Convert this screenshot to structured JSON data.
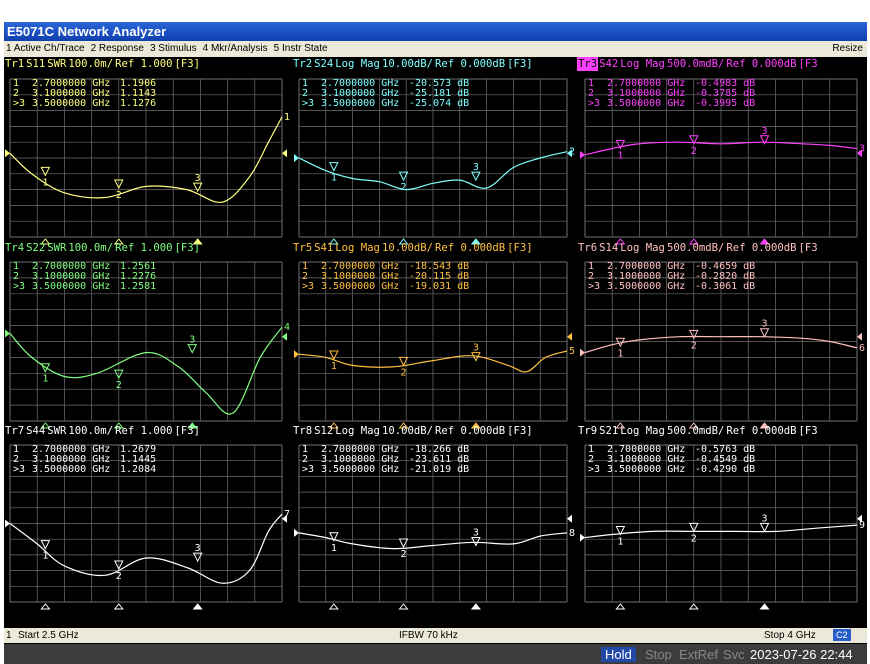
{
  "window": {
    "title": "E5071C Network Analyzer"
  },
  "menu": {
    "items": [
      "1 Active Ch/Trace",
      "2 Response",
      "3 Stimulus",
      "4 Mkr/Analysis",
      "5 Instr State"
    ],
    "resize": "Resize"
  },
  "colors": {
    "grid": "#707070",
    "background": "#000000"
  },
  "panels": [
    {
      "tr": "Tr1",
      "param": "S11",
      "format": "SWR",
      "scale": "100.0m/",
      "ref": "Ref 1.000",
      "tag": "[F3]",
      "color": "#ffff80",
      "active": false,
      "end_label": "1",
      "markers": [
        {
          "n": "1",
          "freq": "2.7000000 GHz",
          "value": "1.1906"
        },
        {
          "n": "2",
          "freq": "3.1000000 GHz",
          "value": "1.1143"
        },
        {
          "n": ">3",
          "freq": "3.5000000 GHz",
          "value": "1.1276"
        }
      ]
    },
    {
      "tr": "Tr2",
      "param": "S24",
      "format": "Log Mag",
      "scale": "10.00dB/",
      "ref": "Ref 0.000dB",
      "tag": "[F3]",
      "color": "#80ffff",
      "active": false,
      "end_label": "2",
      "markers": [
        {
          "n": "1",
          "freq": "2.7000000 GHz",
          "value": "-20.573 dB"
        },
        {
          "n": "2",
          "freq": "3.1000000 GHz",
          "value": "-25.181 dB"
        },
        {
          "n": ">3",
          "freq": "3.5000000 GHz",
          "value": "-25.074 dB"
        }
      ]
    },
    {
      "tr": "Tr3",
      "param": "S42",
      "format": "Log Mag",
      "scale": "500.0mdB/",
      "ref": "Ref 0.000dB",
      "tag": "[F3",
      "color": "#ff40ff",
      "active": true,
      "end_label": "3",
      "markers": [
        {
          "n": "1",
          "freq": "2.7000000 GHz",
          "value": "-0.4983 dB"
        },
        {
          "n": "2",
          "freq": "3.1000000 GHz",
          "value": "-0.3785 dB"
        },
        {
          "n": ">3",
          "freq": "3.5000000 GHz",
          "value": "-0.3995 dB"
        }
      ]
    },
    {
      "tr": "Tr4",
      "param": "S22",
      "format": "SWR",
      "scale": "100.0m/",
      "ref": "Ref 1.000",
      "tag": "[F3]",
      "color": "#80ff80",
      "active": false,
      "end_label": "4",
      "markers": [
        {
          "n": "1",
          "freq": "2.7000000 GHz",
          "value": "1.2561"
        },
        {
          "n": "2",
          "freq": "3.1000000 GHz",
          "value": "1.2276"
        },
        {
          "n": ">3",
          "freq": "3.5000000 GHz",
          "value": "1.2581"
        }
      ]
    },
    {
      "tr": "Tr5",
      "param": "S41",
      "format": "Log Mag",
      "scale": "10.00dB/",
      "ref": "Ref 0.000dB",
      "tag": "[F3]",
      "color": "#ffc040",
      "active": false,
      "end_label": "5",
      "markers": [
        {
          "n": "1",
          "freq": "2.7000000 GHz",
          "value": "-18.543 dB"
        },
        {
          "n": "2",
          "freq": "3.1000000 GHz",
          "value": "-20.115 dB"
        },
        {
          "n": ">3",
          "freq": "3.5000000 GHz",
          "value": "-19.031 dB"
        }
      ]
    },
    {
      "tr": "Tr6",
      "param": "S14",
      "format": "Log Mag",
      "scale": "500.0mdB/",
      "ref": "Ref 0.000dB",
      "tag": "[F3",
      "color": "#ffc0c0",
      "active": false,
      "end_label": "6",
      "markers": [
        {
          "n": "1",
          "freq": "2.7000000 GHz",
          "value": "-0.4659 dB"
        },
        {
          "n": "2",
          "freq": "3.1000000 GHz",
          "value": "-0.2820 dB"
        },
        {
          "n": ">3",
          "freq": "3.5000000 GHz",
          "value": "-0.3061 dB"
        }
      ]
    },
    {
      "tr": "Tr7",
      "param": "S44",
      "format": "SWR",
      "scale": "100.0m/",
      "ref": "Ref 1.000",
      "tag": "[F3]",
      "color": "#ffffff",
      "active": false,
      "end_label": "7",
      "markers": [
        {
          "n": "1",
          "freq": "2.7000000 GHz",
          "value": "1.2679"
        },
        {
          "n": "2",
          "freq": "3.1000000 GHz",
          "value": "1.1445"
        },
        {
          "n": ">3",
          "freq": "3.5000000 GHz",
          "value": "1.2084"
        }
      ]
    },
    {
      "tr": "Tr8",
      "param": "S12",
      "format": "Log Mag",
      "scale": "10.00dB/",
      "ref": "Ref 0.000dB",
      "tag": "[F3]",
      "color": "#ffffff",
      "active": false,
      "end_label": "8",
      "markers": [
        {
          "n": "1",
          "freq": "2.7000000 GHz",
          "value": "-18.266 dB"
        },
        {
          "n": "2",
          "freq": "3.1000000 GHz",
          "value": "-23.611 dB"
        },
        {
          "n": ">3",
          "freq": "3.5000000 GHz",
          "value": "-21.019 dB"
        }
      ]
    },
    {
      "tr": "Tr9",
      "param": "S21",
      "format": "Log Mag",
      "scale": "500.0mdB/",
      "ref": "Ref 0.000dB",
      "tag": "[F3",
      "color": "#ffffff",
      "active": false,
      "end_label": "9",
      "markers": [
        {
          "n": "1",
          "freq": "2.7000000 GHz",
          "value": "-0.5763 dB"
        },
        {
          "n": "2",
          "freq": "3.1000000 GHz",
          "value": "-0.4549 dB"
        },
        {
          "n": ">3",
          "freq": "3.5000000 GHz",
          "value": "-0.4290 dB"
        }
      ]
    }
  ],
  "status": {
    "channel": "1",
    "start": "Start 2.5 GHz",
    "ifbw": "IFBW 70 kHz",
    "stop": "Stop 4 GHz",
    "badge": "C2"
  },
  "bottom": {
    "hold": "Hold",
    "stop": "Stop",
    "extref": "ExtRef",
    "svc": "Svc",
    "datetime": "2023-07-26 22:44"
  }
}
